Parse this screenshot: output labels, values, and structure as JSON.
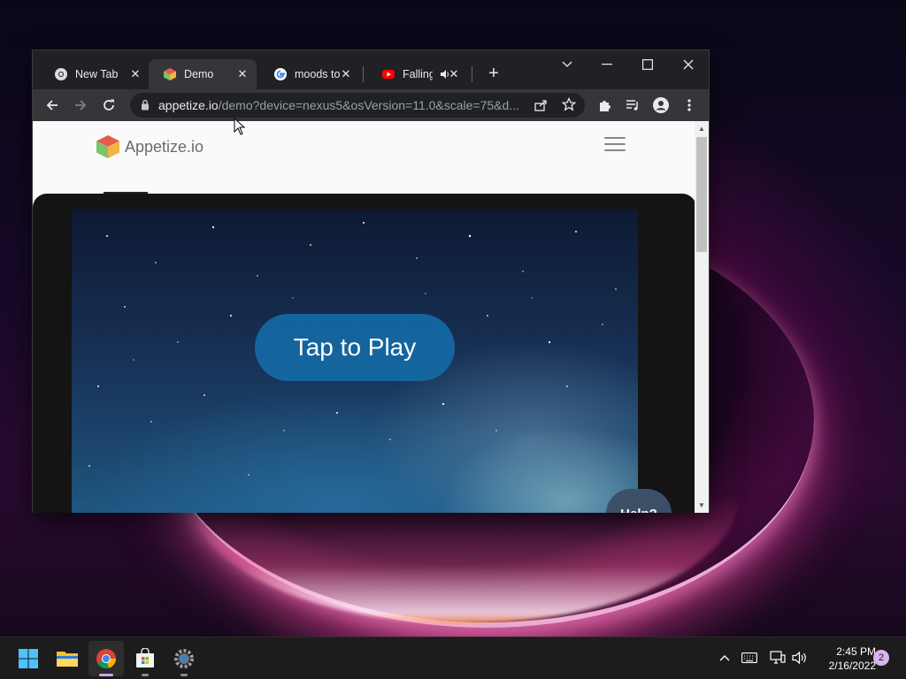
{
  "browser": {
    "tabs": [
      {
        "title": "New Tab",
        "favicon": "chrome-icon",
        "active": false
      },
      {
        "title": "Demo",
        "favicon": "appetize-cube-icon",
        "active": true
      },
      {
        "title": "moods to",
        "favicon": "google-g-icon",
        "active": false
      },
      {
        "title": "Falling",
        "favicon": "youtube-icon",
        "active": false,
        "audio": "speaker-icon"
      }
    ],
    "address": {
      "host": "appetize.io",
      "path": "/demo?device=nexus5&osVersion=11.0&scale=75&d..."
    }
  },
  "page": {
    "brand": "Appetize.io",
    "play_label": "Tap to Play",
    "help_label": "Help?"
  },
  "taskbar": {
    "apps": [
      "start-icon",
      "file-explorer-icon",
      "chrome-icon",
      "microsoft-store-icon",
      "settings-icon"
    ],
    "time": "2:45 PM",
    "date": "2/16/2022",
    "notifications": "2"
  },
  "colors": {
    "chrome_dark": "#202124",
    "chrome_toolbar": "#35363a",
    "play_button": "#1f6ea8",
    "help_button": "#3b4f66"
  }
}
